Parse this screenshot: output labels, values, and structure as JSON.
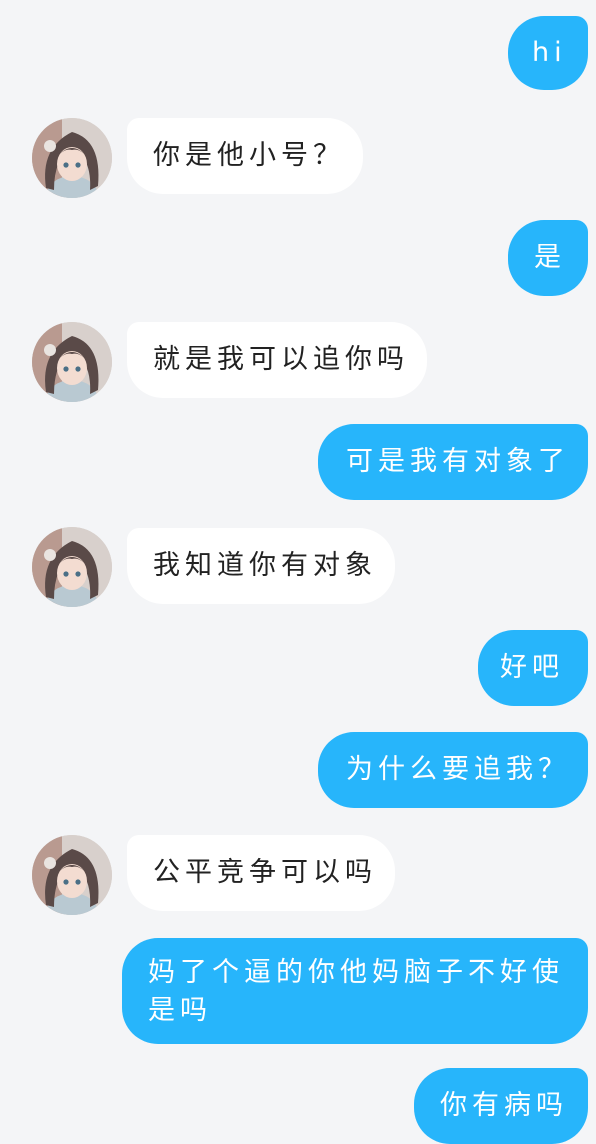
{
  "colors": {
    "background": "#f4f5f7",
    "outgoing_bubble": "#27b5fb",
    "incoming_bubble": "#ffffff",
    "outgoing_text": "#ffffff",
    "incoming_text": "#222222"
  },
  "avatar_icon": "anime-girl-avatar",
  "messages": [
    {
      "side": "out",
      "text": "hi"
    },
    {
      "side": "in",
      "text": "你是他小号？"
    },
    {
      "side": "out",
      "text": "是"
    },
    {
      "side": "in",
      "text": "就是我可以追你吗"
    },
    {
      "side": "out",
      "text": "可是我有对象了"
    },
    {
      "side": "in",
      "text": "我知道你有对象"
    },
    {
      "side": "out",
      "text": "好吧"
    },
    {
      "side": "out",
      "text": "为什么要追我？"
    },
    {
      "side": "in",
      "text": "公平竞争可以吗"
    },
    {
      "side": "out",
      "text": "妈了个逼的你他妈脑子不好使是吗"
    },
    {
      "side": "out",
      "text": "你有病吗"
    }
  ]
}
